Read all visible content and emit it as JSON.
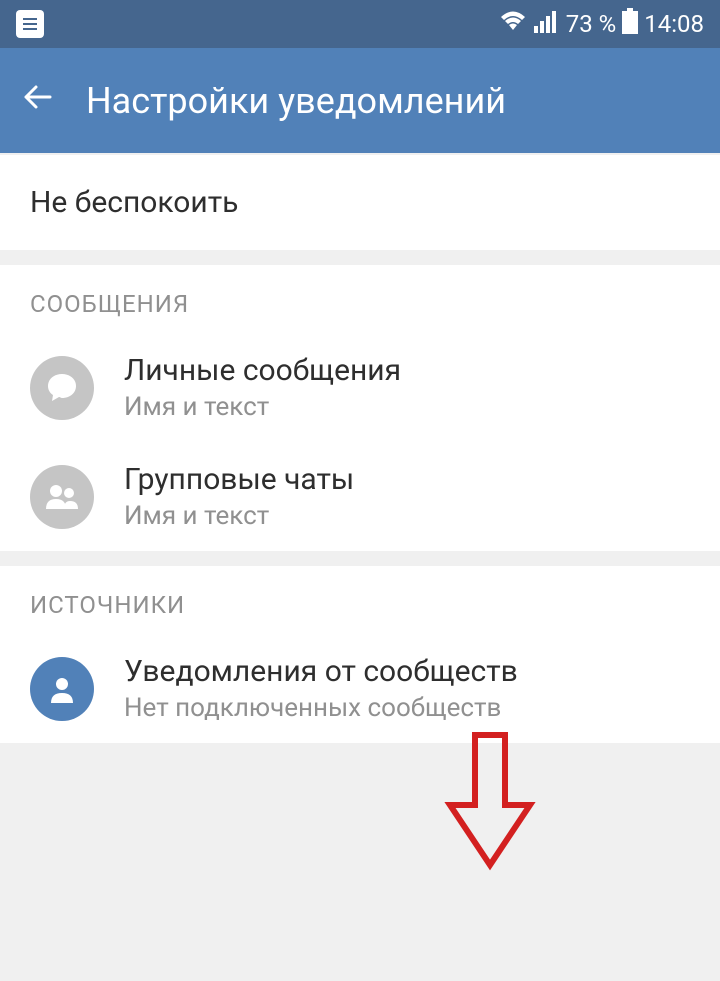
{
  "statusBar": {
    "battery": "73 %",
    "time": "14:08"
  },
  "appBar": {
    "title": "Настройки уведомлений"
  },
  "section1": {
    "item1": {
      "title": "Не беспокоить"
    }
  },
  "section2": {
    "header": "Сообщения",
    "item1": {
      "title": "Личные сообщения",
      "subtitle": "Имя и текст"
    },
    "item2": {
      "title": "Групповые чаты",
      "subtitle": "Имя и текст"
    }
  },
  "section3": {
    "header": "Источники",
    "item1": {
      "title": "Уведомления от сообществ",
      "subtitle": "Нет подключенных сообществ"
    }
  }
}
